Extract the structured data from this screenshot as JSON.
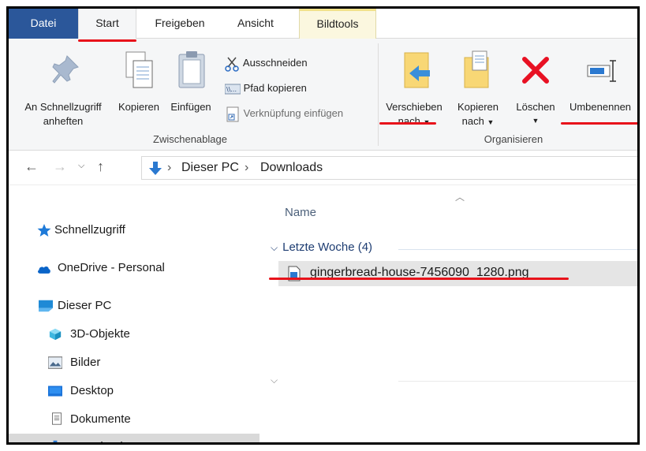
{
  "tabs": {
    "datei": "Datei",
    "start": "Start",
    "freigeben": "Freigeben",
    "ansicht": "Ansicht",
    "bildtools": "Bildtools"
  },
  "ribbon": {
    "clipboard": {
      "pin_label_1": "An Schnellzugriff",
      "pin_label_2": "anheften",
      "copy_label": "Kopieren",
      "paste_label": "Einfügen",
      "cut_label": "Ausschneiden",
      "copy_path_label": "Pfad kopieren",
      "paste_link_label": "Verknüpfung einfügen",
      "group_label": "Zwischenablage"
    },
    "organize": {
      "move_label_1": "Verschieben",
      "move_label_2": "nach",
      "copyto_label_1": "Kopieren",
      "copyto_label_2": "nach",
      "delete_label": "Löschen",
      "rename_label": "Umbenennen",
      "group_label": "Organisieren"
    }
  },
  "address": {
    "crumbs": [
      "Dieser PC",
      "Downloads"
    ]
  },
  "navigation": {
    "quick_access": "Schnellzugriff",
    "onedrive": "OneDrive - Personal",
    "this_pc": "Dieser PC",
    "objects_3d": "3D-Objekte",
    "pictures": "Bilder",
    "desktop": "Desktop",
    "documents": "Dokumente",
    "downloads": "Downloads"
  },
  "content": {
    "column_name": "Name",
    "group_header": "Letzte Woche (4)",
    "files": [
      {
        "name": "gingerbread-house-7456090_1280.png"
      }
    ]
  },
  "colors": {
    "accent": "#2b579a",
    "annotation": "#e8131b",
    "selection": "#d9d9d9"
  }
}
